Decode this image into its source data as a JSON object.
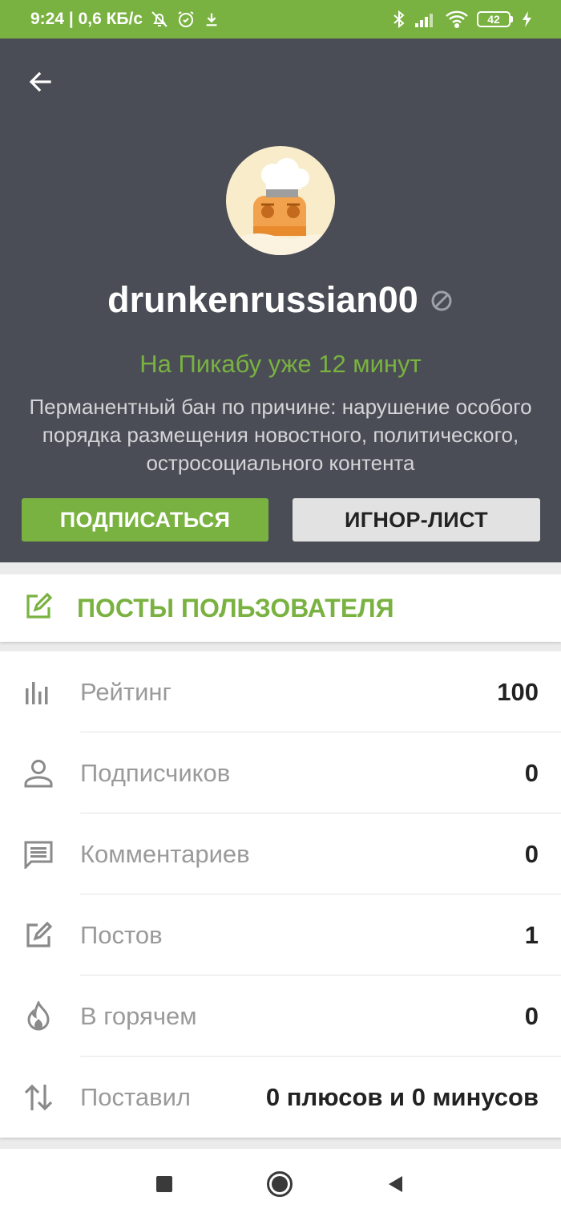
{
  "status_bar": {
    "time_speed": "9:24 | 0,6 КБ/с",
    "battery": "42",
    "icons": [
      "mute-icon",
      "alarm-icon",
      "download-icon",
      "bluetooth-icon",
      "signal-icon",
      "wifi-icon",
      "battery-icon",
      "charging-icon"
    ]
  },
  "profile": {
    "username": "drunkenrussian00",
    "since": "На Пикабу уже 12 минут",
    "ban_reason": "Перманентный бан по причине: нарушение особого порядка размещения новостного, политического, остросоциального контента",
    "subscribe_label": "ПОДПИСАТЬСЯ",
    "ignore_label": "ИГНОР-ЛИСТ"
  },
  "posts_link": {
    "label": "ПОСТЫ ПОЛЬЗОВАТЕЛЯ"
  },
  "stats": [
    {
      "icon": "rating-icon",
      "label": "Рейтинг",
      "value": "100"
    },
    {
      "icon": "person-icon",
      "label": "Подписчиков",
      "value": "0"
    },
    {
      "icon": "comment-icon",
      "label": "Комментариев",
      "value": "0"
    },
    {
      "icon": "edit-icon",
      "label": "Постов",
      "value": "1"
    },
    {
      "icon": "fire-icon",
      "label": "В горячем",
      "value": "0"
    },
    {
      "icon": "sort-arrows-icon",
      "label": "Поставил",
      "value": "0 плюсов и 0 минусов"
    }
  ],
  "colors": {
    "accent": "#7ab241",
    "header_bg": "#4a4d55",
    "page_bg": "#ebebeb"
  }
}
